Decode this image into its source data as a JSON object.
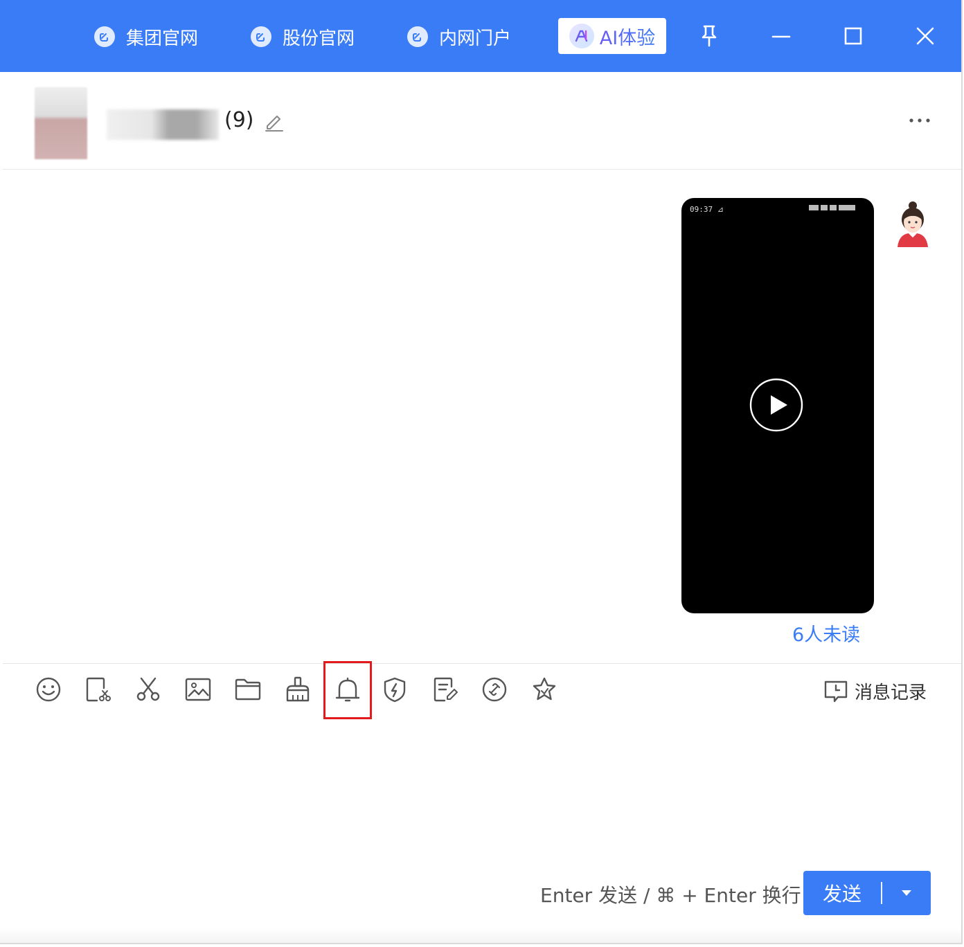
{
  "topbar": {
    "links": [
      "集团官网",
      "股份官网",
      "内网门户"
    ],
    "ai_label": "AI体验"
  },
  "header": {
    "member_count": "(9)"
  },
  "chat": {
    "video_status_time": "09:37 ⊿",
    "unread_label": "6人未读"
  },
  "toolbar": {
    "icons": [
      "emoji-icon",
      "screenshot-icon",
      "scissors-icon",
      "image-icon",
      "folder-icon",
      "broom-icon",
      "bell-icon",
      "shield-icon",
      "note-icon",
      "link-icon",
      "star-icon"
    ],
    "history_label": "消息记录"
  },
  "composer": {
    "hint": "Enter 发送 / ⌘ + Enter 换行",
    "send_label": "发送"
  },
  "colors": {
    "accent": "#3a7cf5",
    "highlight": "#e3191c"
  }
}
